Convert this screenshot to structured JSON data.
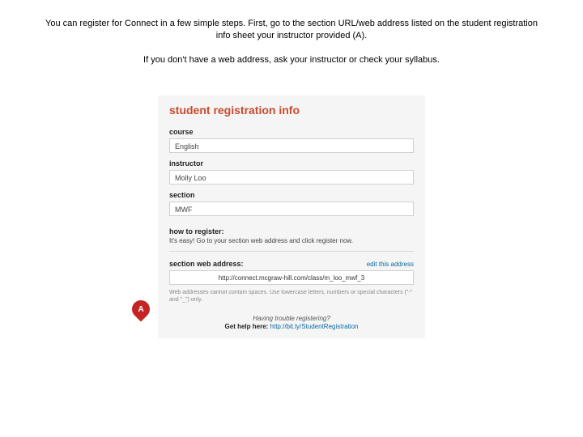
{
  "instructions": {
    "main": "You can register for Connect in a few simple steps. First, go to the section URL/web address listed on the student registration info sheet your instructor provided (A).",
    "sub": "If you don't have a web address, ask your instructor or check your syllabus."
  },
  "sheet": {
    "title": "student registration info",
    "course": {
      "label": "course",
      "value": "English"
    },
    "instructor": {
      "label": "instructor",
      "value": "Molly Loo"
    },
    "section": {
      "label": "section",
      "value": "MWF"
    },
    "howto": {
      "label": "how to register:",
      "text": "It's easy! Go to your section web address and click register now."
    },
    "sectionAddr": {
      "label": "section web address:",
      "editLink": "edit this address",
      "value": "http://connect.mcgraw-hill.com/class/m_loo_mwf_3",
      "note": "Web addresses cannot contain spaces. Use lowercase letters, numbers or special characters (\"-\" and \"_\") only."
    },
    "trouble": {
      "line1": "Having trouble registering?",
      "line2Prefix": "Get help here: ",
      "link": "http://bit.ly/StudentRegistration"
    }
  },
  "marker": "A"
}
